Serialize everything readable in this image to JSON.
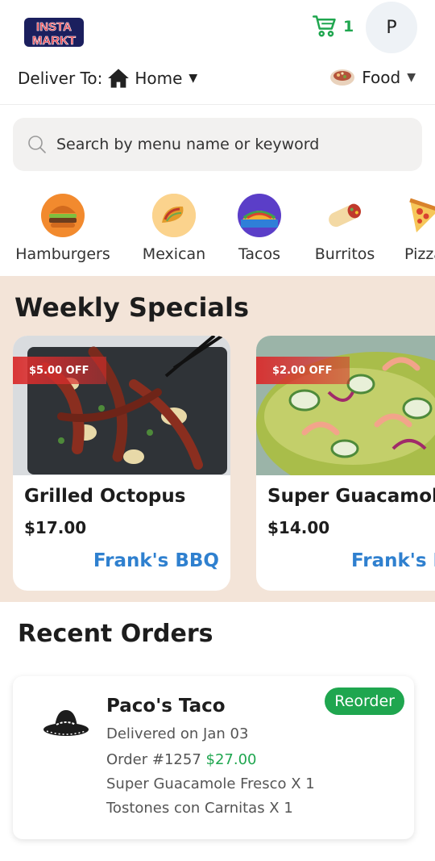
{
  "header": {
    "logo_line1": "INSTA",
    "logo_line2": "MARKT",
    "cart_count": "1",
    "avatar_initial": "P",
    "deliver_label": "Deliver To:",
    "deliver_location": "Home",
    "category_select": "Food"
  },
  "search": {
    "placeholder": "Search by menu name or keyword"
  },
  "categories": [
    {
      "label": "Hamburgers",
      "icon": "hamburger-icon"
    },
    {
      "label": "Mexican",
      "icon": "taco-icon"
    },
    {
      "label": "Tacos",
      "icon": "taco-icon"
    },
    {
      "label": "Burritos",
      "icon": "burrito-icon"
    },
    {
      "label": "Pizza",
      "icon": "pizza-icon"
    }
  ],
  "specials": {
    "title": "Weekly Specials",
    "items": [
      {
        "discount": "$5.00 OFF",
        "name": "Grilled Octopus",
        "price": "$17.00",
        "restaurant": "Frank's BBQ"
      },
      {
        "discount": "$2.00 OFF",
        "name": "Super Guacamole Fresco",
        "price": "$14.00",
        "restaurant": "Frank's BBQ"
      }
    ]
  },
  "recent_orders": {
    "title": "Recent Orders",
    "orders": [
      {
        "restaurant": "Paco's Taco",
        "status": "Delivered on Jan 03",
        "order_number": "Order #1257",
        "total": "$27.00",
        "items": [
          "Super Guacamole Fresco X 1",
          "Tostones con Carnitas X 1"
        ],
        "reorder_label": "Reorder"
      }
    ]
  },
  "colors": {
    "accent_green": "#1fa64f",
    "link_blue": "#2f80cf",
    "specials_bg": "#f3e4d8",
    "discount_red": "#d92d2d"
  }
}
